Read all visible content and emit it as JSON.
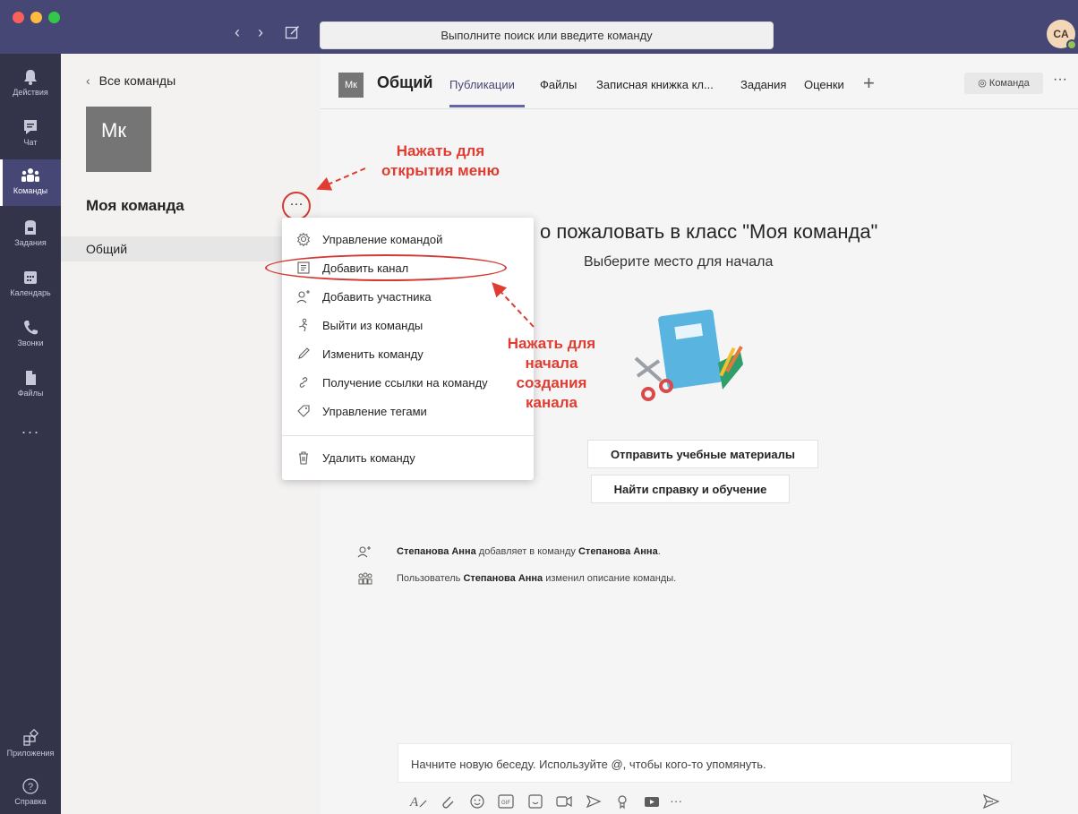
{
  "titlebar": {
    "search_placeholder": "Выполните поиск или введите команду",
    "avatar_initials": "CA"
  },
  "rail": {
    "items": [
      {
        "label": "Действия",
        "icon": "bell-icon"
      },
      {
        "label": "Чат",
        "icon": "chat-icon"
      },
      {
        "label": "Команды",
        "icon": "teams-icon",
        "active": true
      },
      {
        "label": "Задания",
        "icon": "assignments-icon"
      },
      {
        "label": "Календарь",
        "icon": "calendar-icon"
      },
      {
        "label": "Звонки",
        "icon": "phone-icon"
      },
      {
        "label": "Файлы",
        "icon": "files-icon"
      }
    ],
    "more_label": "···",
    "apps_label": "Приложения",
    "help_label": "Справка"
  },
  "team_panel": {
    "back_label": "Все команды",
    "team_initials": "Мк",
    "team_name": "Моя команда",
    "more_label": "···",
    "channels": [
      "Общий"
    ]
  },
  "channel_header": {
    "initials": "Мк",
    "title": "Общий",
    "tabs": [
      "Публикации",
      "Файлы",
      "Записная книжка кл...",
      "Задания",
      "Оценки"
    ],
    "active_tab": "Публикации",
    "add_tab": "+",
    "team_button": "Команда",
    "more_label": "···"
  },
  "welcome": {
    "title": "о пожаловать в класс \"Моя команда\"",
    "subtitle": "Выберите место для начала",
    "button_materials": "Отправить учебные материалы",
    "button_help": "Найти справку и обучение"
  },
  "activity": [
    {
      "icon": "add-person-icon",
      "pre": "",
      "actor": "Степанова Анна",
      "mid": " добавляет в команду ",
      "target": "Степанова Анна",
      "post": "."
    },
    {
      "icon": "team-members-icon",
      "pre": "Пользователь ",
      "actor": "Степанова Анна",
      "mid": " изменил описание команды.",
      "target": "",
      "post": ""
    }
  ],
  "compose": {
    "placeholder": "Начните новую беседу. Используйте @, чтобы кого-то упомянуть.",
    "more_label": "···"
  },
  "menu": {
    "items": [
      {
        "label": "Управление командой",
        "icon": "gear-icon"
      },
      {
        "label": "Добавить канал",
        "icon": "channel-icon"
      },
      {
        "label": "Добавить участника",
        "icon": "add-person-icon"
      },
      {
        "label": "Выйти из команды",
        "icon": "leave-icon"
      },
      {
        "label": "Изменить команду",
        "icon": "pencil-icon"
      },
      {
        "label": "Получение ссылки на команду",
        "icon": "link-icon"
      },
      {
        "label": "Управление тегами",
        "icon": "tag-icon"
      }
    ],
    "delete_label": "Удалить команду"
  },
  "annotations": {
    "top": [
      "Нажать для",
      "открытия меню"
    ],
    "mid": [
      "Нажать для",
      "начала",
      "создания",
      "канала"
    ]
  },
  "colors": {
    "titlebar": "#464775",
    "rail": "#33344a",
    "accent": "#6264a7",
    "annotation": "#e03c31"
  }
}
